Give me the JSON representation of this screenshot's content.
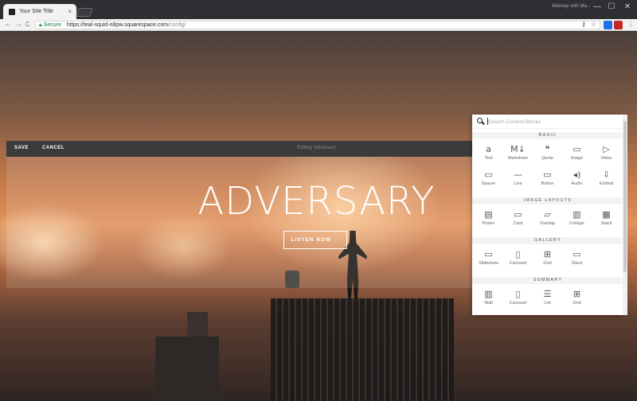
{
  "browser": {
    "tab_title": "Your Site Title",
    "tab_close": "×",
    "profile": "Washay with Ma...",
    "win_min": "—",
    "win_max": "☐",
    "win_close": "✕",
    "back": "←",
    "forward": "→",
    "reload": "C",
    "secure_label": "Secure",
    "url_host": "https://teal-squid-n8pw.squarespace.com",
    "url_path": "/config/",
    "key_icon": "⚷",
    "star_icon": "☆",
    "menu_icon": "⋮"
  },
  "editor": {
    "save_label": "SAVE",
    "cancel_label": "CANCEL",
    "editing_label": "Editing 'Adversary'"
  },
  "hero": {
    "title": "ADVERSARY",
    "button_label": "LISTEN NOW →"
  },
  "panel": {
    "search_placeholder": "Search Content Blocks",
    "sections": [
      {
        "title": "BASIC",
        "blocks": [
          {
            "label": "Text",
            "icon": "a"
          },
          {
            "label": "Markdown",
            "icon": "M↓"
          },
          {
            "label": "Quote",
            "icon": "❝"
          },
          {
            "label": "Image",
            "icon": "▭"
          },
          {
            "label": "Video",
            "icon": "▷"
          },
          {
            "label": "Spacer",
            "icon": "▭"
          },
          {
            "label": "Line",
            "icon": "—"
          },
          {
            "label": "Button",
            "icon": "▭"
          },
          {
            "label": "Audio",
            "icon": "◂)"
          },
          {
            "label": "Embed",
            "icon": "⇩"
          }
        ]
      },
      {
        "title": "IMAGE LAYOUTS",
        "blocks": [
          {
            "label": "Poster",
            "icon": "▤"
          },
          {
            "label": "Card",
            "icon": "▭"
          },
          {
            "label": "Overlap",
            "icon": "▱"
          },
          {
            "label": "Collage",
            "icon": "▥"
          },
          {
            "label": "Stack",
            "icon": "▦"
          }
        ]
      },
      {
        "title": "GALLERY",
        "blocks": [
          {
            "label": "Slideshow",
            "icon": "▭"
          },
          {
            "label": "Carousel",
            "icon": "▯"
          },
          {
            "label": "Grid",
            "icon": "⊞"
          },
          {
            "label": "Stack",
            "icon": "▭"
          }
        ]
      },
      {
        "title": "SUMMARY",
        "blocks": [
          {
            "label": "Wall",
            "icon": "▥"
          },
          {
            "label": "Carousel",
            "icon": "▯"
          },
          {
            "label": "List",
            "icon": "☰"
          },
          {
            "label": "Grid",
            "icon": "⊞"
          }
        ]
      }
    ]
  }
}
